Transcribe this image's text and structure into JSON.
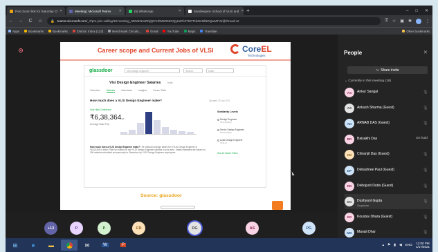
{
  "browser": {
    "tabs": [
      {
        "title": "Post Zoom link for Saturday Cl",
        "color": "#e8a317",
        "active": false
      },
      {
        "title": "Meeting | Microsoft Teams",
        "color": "#6264a7",
        "active": true
      },
      {
        "title": "(5) WhatsApp",
        "color": "#25d366",
        "active": false
      },
      {
        "title": "Sandeepani- School of VLSI and",
        "color": "#ffffff",
        "active": false
      }
    ],
    "url_domain": "teams.microsoft.com",
    "url_path": "/_#/pre-join-calling/19:meeting_NDMzNmZINjQtYzZlMS00ZGQyLWFiZTItOTNiZmNlNDQwMTVk@thread.v2",
    "bookmarks": [
      "Apps",
      "Bookmarks",
      "Bookmarks",
      "Zimbra: Inbox (123)",
      "Benchmark Circuits...",
      "Gmail",
      "YouTube",
      "Maps",
      "Translate"
    ],
    "other_bookmarks": "Other bookmarks"
  },
  "slide": {
    "title": "Career scope and Current Jobs of VLSI",
    "logo_main_1": "Core",
    "logo_main_2": "EL",
    "logo_sub": "Technologies",
    "source": "Source: glassdoor",
    "glassdoor": {
      "logo": "glassdoor",
      "search_placeholder": "Vlsi design engineer",
      "search_loc": "Search",
      "search_btn": "India",
      "heading": "Vlsi Design Engineer Salaries",
      "heading_sub": "India",
      "tabs": [
        "Overview",
        "Salaries",
        "Interviews",
        "Insights",
        "Career Path"
      ],
      "question": "How much does a VLSI Design Engineer make?",
      "updated": "Updated 20 Jan 2021",
      "verified": "Very High Confidence",
      "salary": "₹6,38,364",
      "salary_unit": "/yr",
      "salary_label": "Average Base Pay",
      "similarity_title": "Similarity Levels",
      "similar": [
        {
          "name": "Design Engineer",
          "value": "₹3,34,000/yr"
        },
        {
          "name": "Senior Design Engineer",
          "value": "₹8,00,000/yr"
        },
        {
          "name": "Lead Design Engineer",
          "value": "₹13L/yr"
        }
      ],
      "side_link": "See all Career Paths",
      "para_bold": "How much does a VLSI Design Engineer make?",
      "para": "The national average salary for a VLSI Design Engineer is ₹6,38,364 in India. Filter by location to see VLSI Design Engineer salaries in your area. Salary estimates are based on 156 salaries submitted anonymously to Glassdoor by VLSI Design Engineer employees.",
      "histogram": [
        0.08,
        0.18,
        0.45,
        0.9,
        0.55,
        0.28,
        0.16,
        0.12,
        0.08
      ]
    }
  },
  "strip": [
    {
      "label": "+13",
      "bg": "#6264a7",
      "fg": "#ffffff"
    },
    {
      "label": "P",
      "bg": "#e9d5ff",
      "fg": "#5b3b8c"
    },
    {
      "label": "P",
      "bg": "#d3f1cf",
      "fg": "#2e6b2a"
    },
    {
      "label": "CD",
      "bg": "#fce1b8",
      "fg": "#8a5a10"
    },
    {
      "label": "DG",
      "bg": "#e3e3e3",
      "fg": "#444444",
      "ring": true
    },
    {
      "label": "AS",
      "bg": "#f9d4e4",
      "fg": "#8b2a55"
    },
    {
      "label": "PG",
      "bg": "#cfe3f7",
      "fg": "#2b5b8a"
    }
  ],
  "panel": {
    "title": "People",
    "invite": "Share invite",
    "section": "Currently in this meeting (18)",
    "people": [
      {
        "initials": "AS",
        "name": "Ankur Sangal",
        "role": "",
        "status": "",
        "bg": "#f9d4e4",
        "fg": "#8b2a55"
      },
      {
        "initials": "AS",
        "name": "Ankush Sharma (Guest)",
        "role": "",
        "status": "",
        "bg": "#e3e3e3",
        "fg": "#444444"
      },
      {
        "initials": "AD",
        "name": "ARNAB DAS (Guest)",
        "role": "",
        "status": "",
        "bg": "#cfe3f7",
        "fg": "#2b5b8a"
      },
      {
        "initials": "BD",
        "name": "Baisakhi Das",
        "role": "",
        "status": "On hold",
        "bg": "#f9d4e4",
        "fg": "#8b2a55"
      },
      {
        "initials": "CD",
        "name": "Chiranjit Das (Guest)",
        "role": "",
        "status": "",
        "bg": "#fce1b8",
        "fg": "#8a5a10"
      },
      {
        "initials": "DP",
        "name": "Debashree Paul (Guest)",
        "role": "",
        "status": "",
        "bg": "#cfe3f7",
        "fg": "#2b5b8a"
      },
      {
        "initials": "DD",
        "name": "Debojyoti Dutta (Guest)",
        "role": "",
        "status": "",
        "bg": "#f9d4e4",
        "fg": "#8b2a55"
      },
      {
        "initials": "DG",
        "name": "Dushyant Gupta",
        "role": "Organizer",
        "status": "",
        "bg": "#e3e3e3",
        "fg": "#444444"
      },
      {
        "initials": "KD",
        "name": "Koustav Dhara (Guest)",
        "role": "",
        "status": "",
        "bg": "#f9d4e4",
        "fg": "#8b2a55"
      },
      {
        "initials": "MD",
        "name": "Manali Dhar",
        "role": "",
        "status": "",
        "bg": "#cfe3f7",
        "fg": "#2b5b8a"
      }
    ]
  },
  "taskbar": {
    "time": "12:00 PM",
    "date": "1/17/2021",
    "lang": "ENG"
  }
}
